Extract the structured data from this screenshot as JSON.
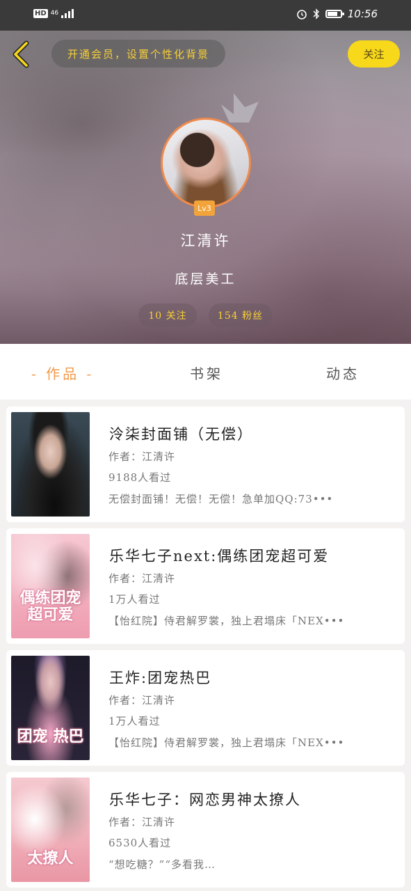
{
  "statusbar": {
    "hd": "HD",
    "network": "46",
    "time": "10:56"
  },
  "header": {
    "vip_text": "开通会员，设置个性化背景",
    "follow_label": "关注",
    "level": "Lv3",
    "username": "江清许",
    "user_title": "底层美工",
    "following": "10 关注",
    "fans": "154 粉丝"
  },
  "tabs": {
    "works": "- 作品 -",
    "shelf": "书架",
    "feed": "动态"
  },
  "works": [
    {
      "title": "泠柒封面铺（无偿）",
      "author": "作者：江清许",
      "views": "9188人看过",
      "desc": "无偿封面铺！无偿！无偿！急单加QQ:73•••",
      "cover_text": ""
    },
    {
      "title": "乐华七子next:偶练团宠超可爱",
      "author": "作者：江清许",
      "views": "1万人看过",
      "desc": "【怡红院】侍君解罗裳，独上君塌床「NEX•••",
      "cover_text": "偶练团宠 超可爱"
    },
    {
      "title": "王炸:团宠热巴",
      "author": "作者：江清许",
      "views": "1万人看过",
      "desc": "【怡红院】侍君解罗裳，独上君塌床「NEX•••",
      "cover_text": "团宠 热巴"
    },
    {
      "title": "乐华七子：网恋男神太撩人",
      "author": "作者：江清许",
      "views": "6530人看过",
      "desc": "“想吃糖？”“多看我…",
      "cover_text": "太撩人"
    }
  ],
  "colors": {
    "accent_yellow": "#f8d81a",
    "accent_orange": "#f19a4a",
    "status_bar": "#3a3a3a"
  }
}
